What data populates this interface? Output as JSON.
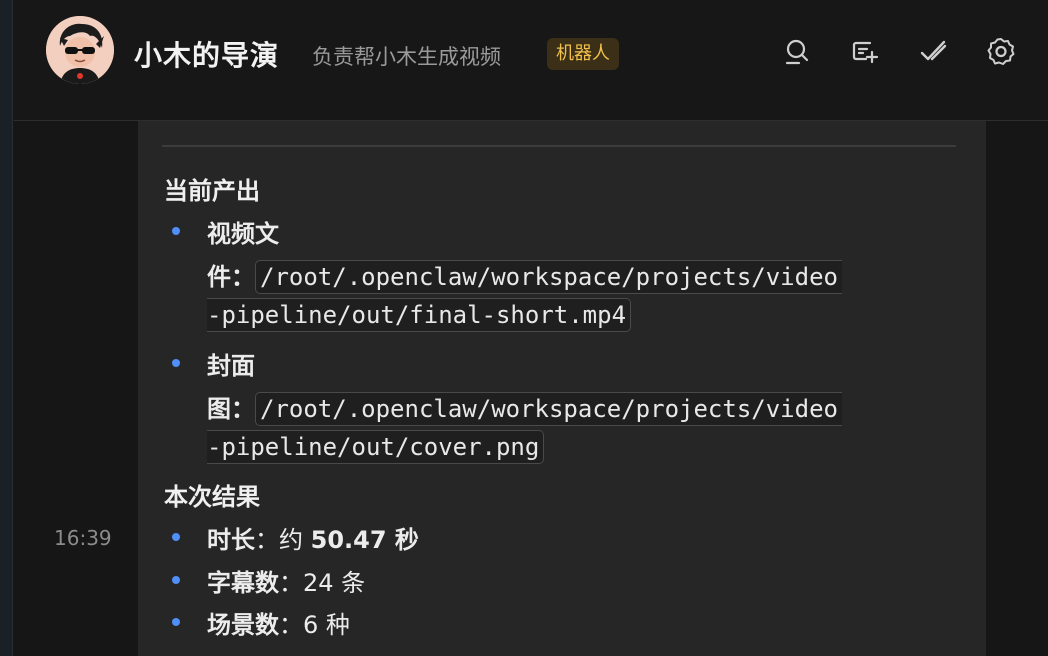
{
  "header": {
    "title": "小木的导演",
    "subtitle": "负责帮小木生成视频",
    "badge": "机器人",
    "icons": [
      "search-icon",
      "new-chat-icon",
      "check-icon",
      "settings-icon"
    ]
  },
  "message": {
    "time": "16:39",
    "sections": [
      {
        "title": "当前产出",
        "items": [
          {
            "label_line1": "视频文",
            "label_line2": "件：",
            "path_part1": "/root/.openclaw/workspace/projects/video",
            "path_part2": "-pipeline/out/final-short.mp4"
          },
          {
            "label_line1": "封面",
            "label_line2": "图：",
            "path_part1": "/root/.openclaw/workspace/projects/video",
            "path_part2": "-pipeline/out/cover.png"
          }
        ]
      },
      {
        "title": "本次结果",
        "items": [
          {
            "label": "时长",
            "sep": "：约 ",
            "value": "50.47",
            "unit": " 秒"
          },
          {
            "label": "字幕数",
            "sep": "：",
            "value": "24",
            "unit": " 条"
          },
          {
            "label": "场景数",
            "sep": "：",
            "value": "6",
            "unit": " 种"
          }
        ]
      }
    ]
  },
  "colors": {
    "accent_bullet": "#4f8ff7",
    "badge_text": "#f2c04b",
    "badge_bg": "#3b3017"
  }
}
